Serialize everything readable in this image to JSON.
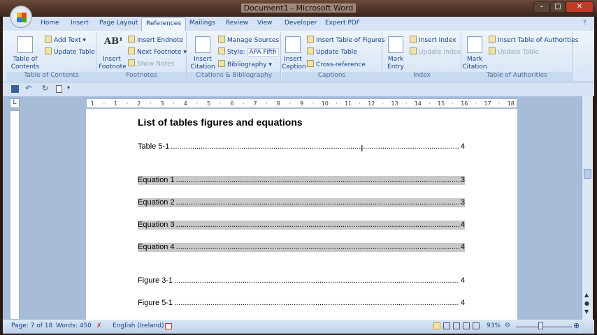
{
  "window": {
    "title": "Document1 - Microsoft Word",
    "min": "–",
    "max": "□",
    "close": "✕"
  },
  "tabs": [
    "Home",
    "Insert",
    "Page Layout",
    "References",
    "Mailings",
    "Review",
    "View",
    "Developer",
    "Expert PDF"
  ],
  "ribbon": {
    "toc": {
      "big": "Table of Contents ▾",
      "add_text": "Add Text ▾",
      "update_table": "Update Table",
      "label": "Table of Contents"
    },
    "footnotes": {
      "big": "Insert Footnote",
      "insert_endnote": "Insert Endnote",
      "next_footnote": "Next Footnote ▾",
      "show_notes": "Show Notes",
      "label": "Footnotes"
    },
    "citations": {
      "big": "Insert Citation ▾",
      "manage_sources": "Manage Sources",
      "style_label": "Style:",
      "style_value": "APA Fifth",
      "bibliography": "Bibliography ▾",
      "label": "Citations & Bibliography"
    },
    "captions": {
      "big": "Insert Caption",
      "insert_tof": "Insert Table of Figures",
      "update_table": "Update Table",
      "cross_reference": "Cross-reference",
      "label": "Captions"
    },
    "index": {
      "big": "Mark Entry",
      "insert_index": "Insert Index",
      "update_index": "Update Index",
      "label": "Index"
    },
    "toa": {
      "big": "Mark Citation",
      "insert_toa": "Insert Table of Authorities",
      "update_table": "Update Table",
      "label": "Table of Authorities"
    }
  },
  "ruler": [
    "1",
    "·",
    "1",
    "·",
    "2",
    "·",
    "3",
    "·",
    "4",
    "·",
    "5",
    "·",
    "6",
    "·",
    "7",
    "·",
    "8",
    "·",
    "9",
    "·",
    "10",
    "·",
    "11",
    "·",
    "12",
    "·",
    "13",
    "·",
    "14",
    "·",
    "15",
    "·",
    "16",
    "·",
    "17",
    "·",
    "18"
  ],
  "document": {
    "heading": "List of tables figures and equations",
    "entries": [
      {
        "label": "Table 5-1",
        "page": "4",
        "highlight": false
      },
      {
        "label": "Equation 1",
        "page": "3",
        "highlight": true
      },
      {
        "label": "Equation 2",
        "page": "3",
        "highlight": true
      },
      {
        "label": "Equation 3",
        "page": "4",
        "highlight": true
      },
      {
        "label": "Equation 4",
        "page": "4",
        "highlight": true
      },
      {
        "label": "Figure 3-1",
        "page": "4",
        "highlight": false
      },
      {
        "label": "Figure 5-1",
        "page": "4",
        "highlight": false
      }
    ]
  },
  "status": {
    "page": "Page: 7 of 18",
    "words": "Words: 450",
    "language": "English (Ireland)",
    "zoom": "93%"
  }
}
